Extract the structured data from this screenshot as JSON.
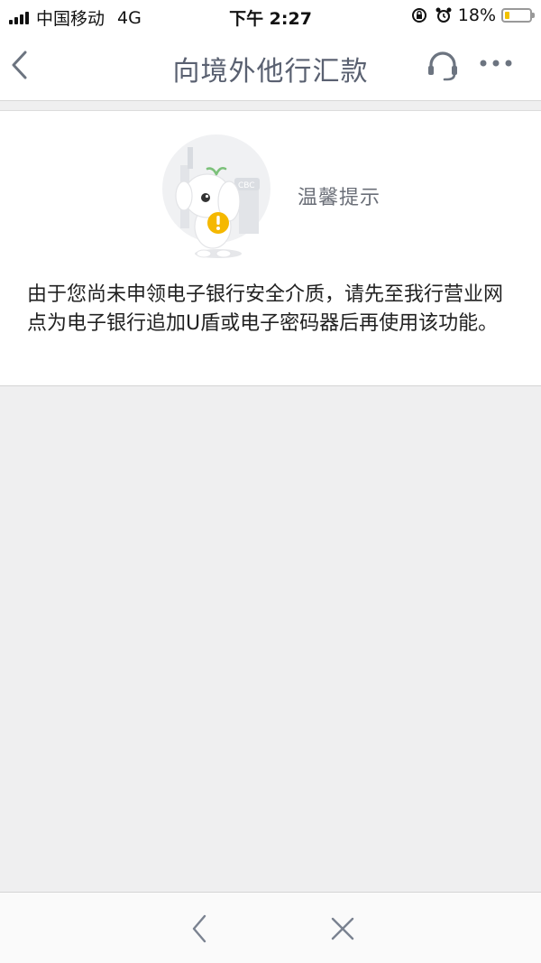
{
  "status_bar": {
    "carrier": "中国移动",
    "network": "4G",
    "time": "下午 2:27",
    "battery_percent": "18%",
    "battery_level": 0.18
  },
  "nav": {
    "title": "向境外他行汇款",
    "back_icon": "chevron-left-icon",
    "service_icon": "headset-icon",
    "more_icon": "more-dots-icon"
  },
  "tip": {
    "title": "温馨提示",
    "message": "由于您尚未申领电子银行安全介质，请先至我行营业网点为电子银行追加U盾或电子密码器后再使用该功能。",
    "mascot_badge": "CBC"
  },
  "bottom_bar": {
    "back_icon": "chevron-left-icon",
    "close_icon": "close-icon"
  },
  "colors": {
    "nav_title": "#5a6171",
    "background": "#efeff0",
    "warning_badge": "#f5b800",
    "leaf": "#7cc17a"
  }
}
